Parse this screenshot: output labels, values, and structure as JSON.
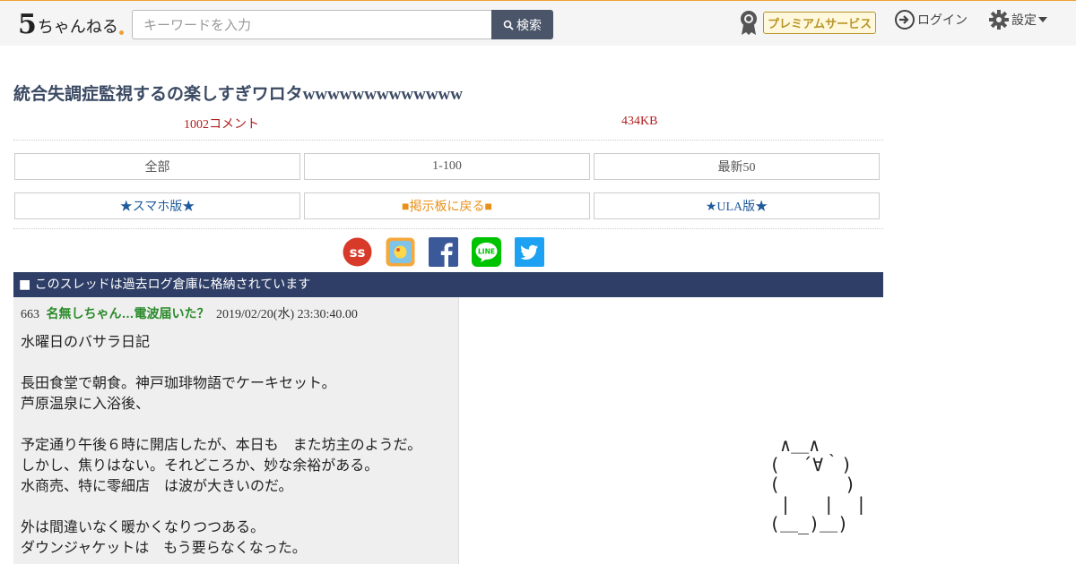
{
  "header": {
    "logo_five": "5",
    "logo_rest": "ちゃんねる",
    "search_placeholder": "キーワードを入力",
    "search_label": "検索",
    "premium_label": "プレミアムサービス",
    "login_label": "ログイン",
    "settings_label": "設定"
  },
  "thread": {
    "title": "統合失調症監視するの楽しすぎワロタwwwwwwwwwwwww",
    "comments": "1002コメント",
    "size": "434KB"
  },
  "nav": {
    "row1": [
      "全部",
      "1-100",
      "最新50"
    ],
    "row2": [
      "★スマホ版★",
      "■掲示板に戻る■",
      "★ULA版★"
    ]
  },
  "share_icons": [
    "sss-icon",
    "bookmark-app-icon",
    "facebook-icon",
    "line-icon",
    "twitter-icon"
  ],
  "archived_notice": "■ このスレッドは過去ログ倉庫に格納されています",
  "post": {
    "number": "663",
    "name": "名無しちゃん…電波届いた？",
    "date": "2019/02/20(水) 23:30:40.00",
    "lines": [
      "水曜日のバサラ日記",
      "",
      "長田食堂で朝食。神戸珈琲物語でケーキセット。",
      "芦原温泉に入浴後、",
      "",
      "予定通り午後６時に開店したが、本日も　また坊主のようだ。",
      "しかし、焦りはない。それどころか、妙な余裕がある。",
      "水商売、特に零細店　は波が大きいのだ。",
      "",
      "外は間違いなく暖かくなりつつある。",
      "ダウンジャケットは　もう要らなくなった。"
    ]
  },
  "ascii_art": " ∧＿∧\n(  ´∀｀)\n(      )\n |   |  |\n(＿_)＿)",
  "colors": {
    "title": "#3b4a63",
    "meta_red": "#b02020",
    "archived_bg": "#2e3e66",
    "poster_green": "#2a8a2a",
    "nav_blue": "#1e5a9c",
    "nav_orange": "#e8901a"
  }
}
